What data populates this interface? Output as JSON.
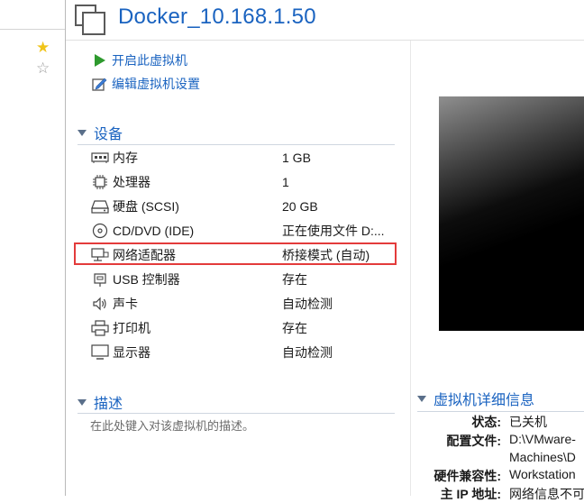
{
  "vm": {
    "title": "Docker_10.168.1.50"
  },
  "actions": [
    {
      "label": "开启此虚拟机",
      "icon": "play-icon"
    },
    {
      "label": "编辑虚拟机设置",
      "icon": "edit-settings-icon"
    }
  ],
  "devices_section": {
    "title": "设备"
  },
  "devices": [
    {
      "icon": "memory-icon",
      "name": "内存",
      "value": "1 GB"
    },
    {
      "icon": "processor-icon",
      "name": "处理器",
      "value": "1"
    },
    {
      "icon": "hard-disk-icon",
      "name": "硬盘 (SCSI)",
      "value": "20 GB"
    },
    {
      "icon": "cd-dvd-icon",
      "name": "CD/DVD (IDE)",
      "value": "正在使用文件 D:..."
    },
    {
      "icon": "network-adapter-icon",
      "name": "网络适配器",
      "value": "桥接模式 (自动)"
    },
    {
      "icon": "usb-icon",
      "name": "USB 控制器",
      "value": "存在"
    },
    {
      "icon": "sound-card-icon",
      "name": "声卡",
      "value": "自动检测"
    },
    {
      "icon": "printer-icon",
      "name": "打印机",
      "value": "存在"
    },
    {
      "icon": "display-icon",
      "name": "显示器",
      "value": "自动检测"
    }
  ],
  "description_section": {
    "title": "描述",
    "placeholder": "在此处键入对该虚拟机的描述。"
  },
  "details_section": {
    "title": "虚拟机详细信息",
    "rows": [
      {
        "label": "状态:",
        "value": "已关机"
      },
      {
        "label": "配置文件:",
        "value": "D:\\VMware-"
      },
      {
        "label": "",
        "value": "Machines\\D"
      },
      {
        "label": "硬件兼容性:",
        "value": "Workstation"
      },
      {
        "label": "主 IP 地址:",
        "value": "网络信息不可"
      }
    ]
  },
  "colors": {
    "accent": "#1a63c0",
    "highlight_border": "#e33b3b",
    "play_green": "#2e9a2e",
    "star_yellow": "#f0c419"
  }
}
